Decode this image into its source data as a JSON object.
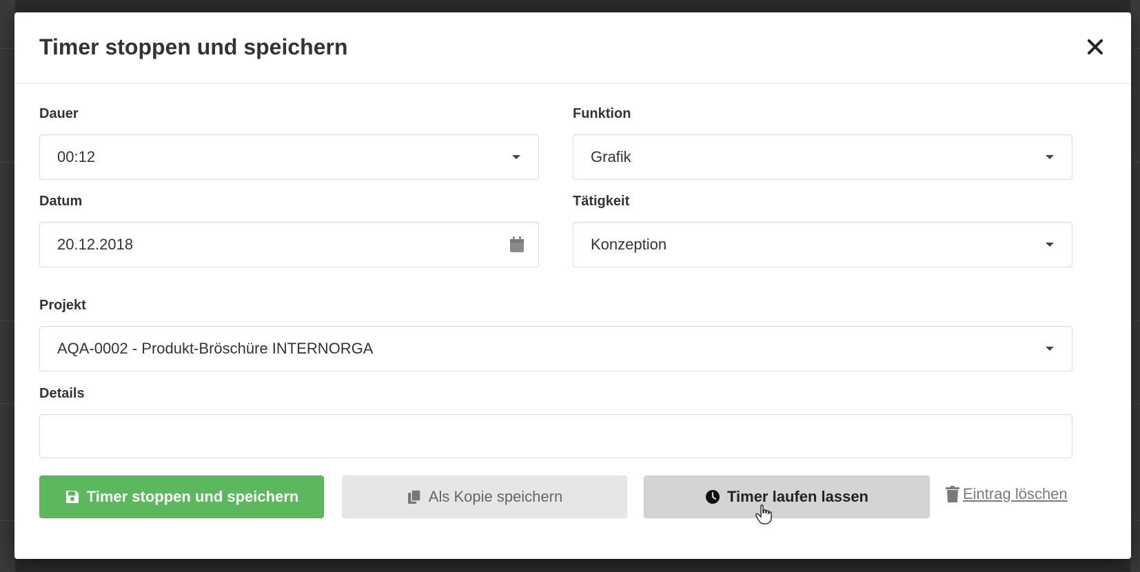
{
  "modal": {
    "title": "Timer stoppen und speichern"
  },
  "form": {
    "dauer": {
      "label": "Dauer",
      "value": "00:12"
    },
    "funktion": {
      "label": "Funktion",
      "value": "Grafik"
    },
    "datum": {
      "label": "Datum",
      "value": "20.12.2018"
    },
    "taetigkeit": {
      "label": "Tätigkeit",
      "value": "Konzeption"
    },
    "projekt": {
      "label": "Projekt",
      "value": "AQA-0002 - Produkt-Bröschüre INTERNORGA"
    },
    "details": {
      "label": "Details",
      "value": ""
    }
  },
  "actions": {
    "save": "Timer stoppen und speichern",
    "copy": "Als Kopie speichern",
    "keep_running": "Timer laufen lassen",
    "delete": "Eintrag löschen"
  },
  "colors": {
    "primary_green": "#5cb85c",
    "light_button": "#e6e6e6",
    "mid_button": "#d4d4d4",
    "backdrop": "#2b2b2b"
  },
  "icons": {
    "close": "close-icon",
    "save": "floppy-disk-icon",
    "copy": "copy-icon",
    "clock": "clock-icon",
    "trash": "trash-icon",
    "calendar": "calendar-icon",
    "dropdown": "caret-down-icon"
  }
}
